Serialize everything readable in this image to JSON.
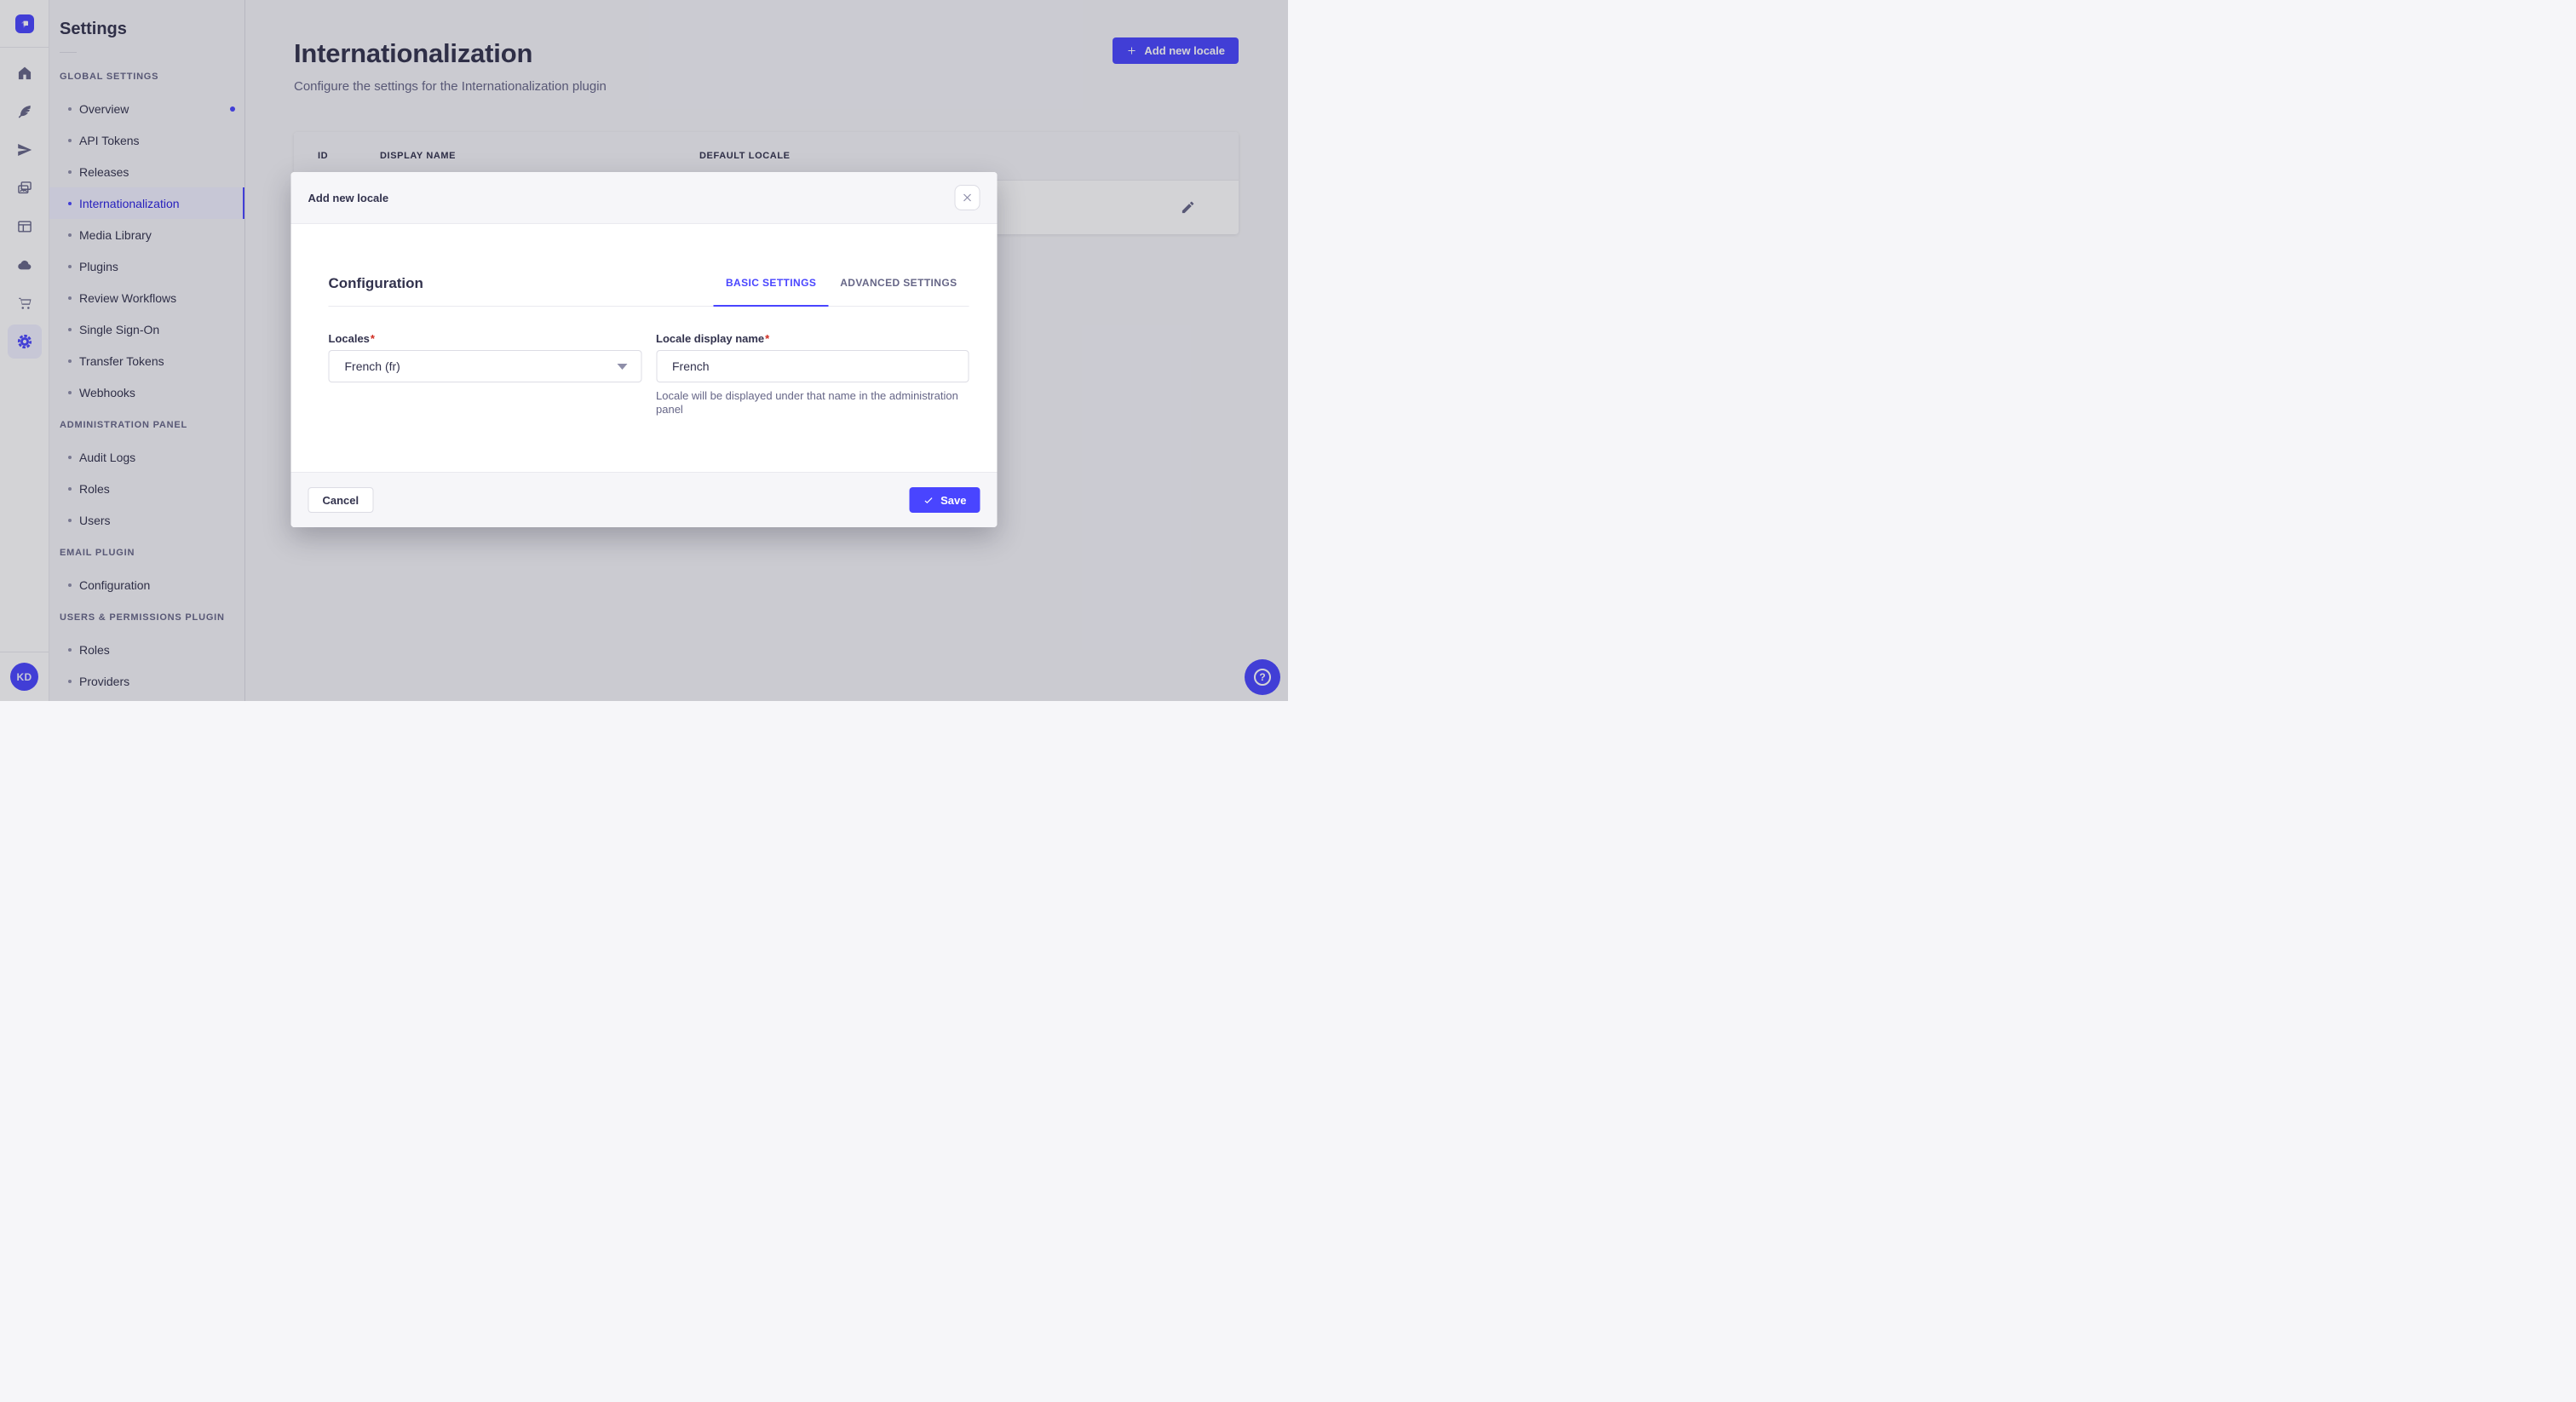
{
  "app": {
    "user_initials": "KD",
    "help_label": "?"
  },
  "sidebar": {
    "title": "Settings",
    "sections": [
      {
        "label": "GLOBAL SETTINGS",
        "items": [
          {
            "label": "Overview",
            "dot": true
          },
          {
            "label": "API Tokens"
          },
          {
            "label": "Releases"
          },
          {
            "label": "Internationalization",
            "active": true
          },
          {
            "label": "Media Library"
          },
          {
            "label": "Plugins"
          },
          {
            "label": "Review Workflows"
          },
          {
            "label": "Single Sign-On"
          },
          {
            "label": "Transfer Tokens"
          },
          {
            "label": "Webhooks"
          }
        ]
      },
      {
        "label": "ADMINISTRATION PANEL",
        "items": [
          {
            "label": "Audit Logs"
          },
          {
            "label": "Roles"
          },
          {
            "label": "Users"
          }
        ]
      },
      {
        "label": "EMAIL PLUGIN",
        "items": [
          {
            "label": "Configuration"
          }
        ]
      },
      {
        "label": "USERS & PERMISSIONS PLUGIN",
        "items": [
          {
            "label": "Roles"
          },
          {
            "label": "Providers"
          }
        ]
      }
    ]
  },
  "header": {
    "title": "Internationalization",
    "subtitle": "Configure the settings for the Internationalization plugin",
    "add_button": "Add new locale"
  },
  "table": {
    "columns": [
      "ID",
      "DISPLAY NAME",
      "DEFAULT LOCALE"
    ]
  },
  "modal": {
    "title": "Add new locale",
    "section_title": "Configuration",
    "tabs": [
      {
        "label": "BASIC SETTINGS",
        "active": true
      },
      {
        "label": "ADVANCED SETTINGS"
      }
    ],
    "required_mark": "*",
    "fields": {
      "locales": {
        "label": "Locales",
        "value": "French (fr)"
      },
      "display_name": {
        "label": "Locale display name",
        "value": "French",
        "helper": "Locale will be displayed under that name in the administration panel"
      }
    },
    "cancel": "Cancel",
    "save": "Save"
  },
  "colors": {
    "primary": "#4945ff",
    "primary_active_text": "#271fe0",
    "primary_bg": "#f0f0ff",
    "text": "#32324d",
    "muted": "#666687",
    "border": "#dcdce4",
    "background": "#f6f6f9",
    "surface": "#ffffff",
    "required": "#d02b20",
    "overlay": "rgba(33,33,52,0.2)"
  }
}
